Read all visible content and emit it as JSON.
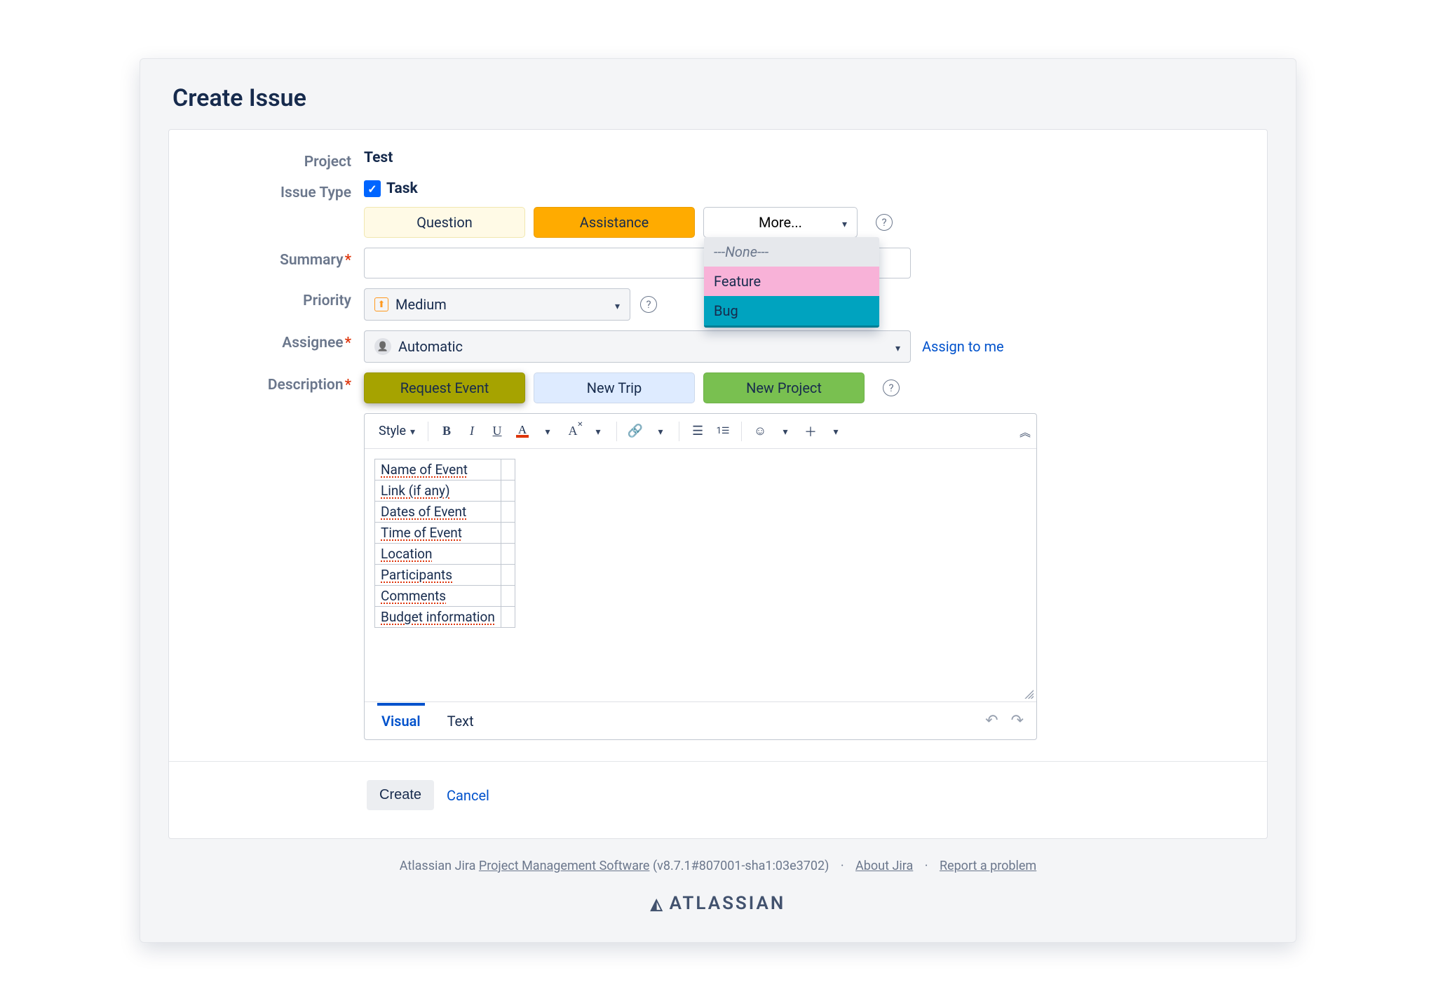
{
  "title": "Create Issue",
  "fields": {
    "project": {
      "label": "Project",
      "value": "Test"
    },
    "issueType": {
      "label": "Issue Type",
      "value": "Task"
    },
    "summary": {
      "label": "Summary"
    },
    "priority": {
      "label": "Priority",
      "value": "Medium"
    },
    "assignee": {
      "label": "Assignee",
      "value": "Automatic",
      "assignToMe": "Assign to me"
    },
    "description": {
      "label": "Description"
    }
  },
  "issueTypeButtons": {
    "question": "Question",
    "assistance": "Assistance",
    "more": "More..."
  },
  "moreDropdown": {
    "none": "---None---",
    "feature": "Feature",
    "bug": "Bug"
  },
  "descButtons": {
    "requestEvent": "Request Event",
    "newTrip": "New Trip",
    "newProject": "New Project"
  },
  "toolbar": {
    "style": "Style"
  },
  "descTable": [
    "Name of Event",
    "Link (if any)",
    "Dates of Event",
    "Time of Event",
    "Location",
    "Participants",
    "Comments",
    "Budget information"
  ],
  "editorModes": {
    "visual": "Visual",
    "text": "Text"
  },
  "actions": {
    "create": "Create",
    "cancel": "Cancel"
  },
  "footer": {
    "lead": "Atlassian Jira ",
    "pms": "Project Management Software",
    "version": " (v8.7.1#807001-sha1:03e3702)",
    "about": "About Jira",
    "report": "Report a problem",
    "brand": "ATLASSIAN"
  }
}
